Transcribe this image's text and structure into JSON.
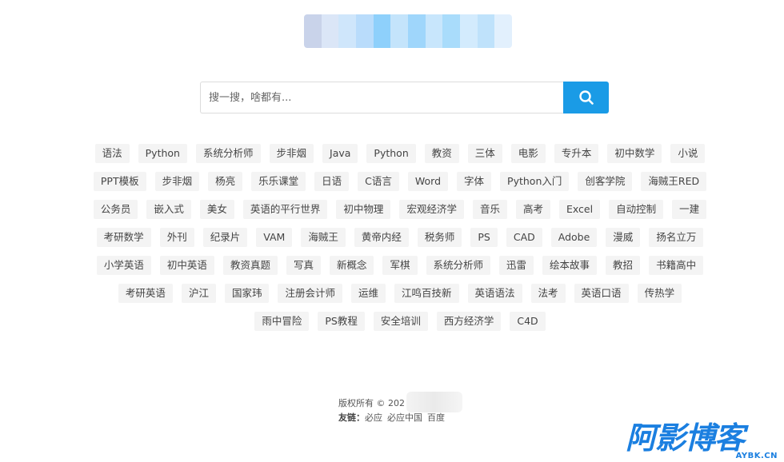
{
  "search": {
    "placeholder": "搜一搜，啥都有...",
    "button_icon": "search-icon",
    "accent_color": "#1a9be6"
  },
  "tags": [
    "语法",
    "Python",
    "系统分析师",
    "步非烟",
    "Java",
    "Python",
    "教资",
    "三体",
    "电影",
    "专升本",
    "初中数学",
    "小说",
    "PPT模板",
    "步非烟",
    "杨亮",
    "乐乐课堂",
    "日语",
    "C语言",
    "Word",
    "字体",
    "Python入门",
    "创客学院",
    "海贼王RED",
    "公务员",
    "嵌入式",
    "美女",
    "英语的平行世界",
    "初中物理",
    "宏观经济学",
    "音乐",
    "高考",
    "Excel",
    "自动控制",
    "一建",
    "考研数学",
    "外刊",
    "纪录片",
    "VAM",
    "海贼王",
    "黄帝内经",
    "税务师",
    "PS",
    "CAD",
    "Adobe",
    "漫威",
    "扬名立万",
    "小学英语",
    "初中英语",
    "教资真题",
    "写真",
    "新概念",
    "军棋",
    "系统分析师",
    "迅雷",
    "绘本故事",
    "教招",
    "书籍高中",
    "考研英语",
    "沪江",
    "国家玮",
    "注册会计师",
    "运维",
    "江鸣百技新",
    "英语语法",
    "法考",
    "英语口语",
    "传热学",
    "雨中冒险",
    "PS教程",
    "安全培训",
    "西方经济学",
    "C4D"
  ],
  "footer": {
    "copyright": "版权所有 © 202",
    "friends_label": "友链：",
    "links": [
      "必应",
      "必应中国",
      "百度"
    ]
  },
  "watermark": {
    "title": "阿影博客",
    "domain": "AYBK.CN",
    "color": "#1b7fe0"
  }
}
